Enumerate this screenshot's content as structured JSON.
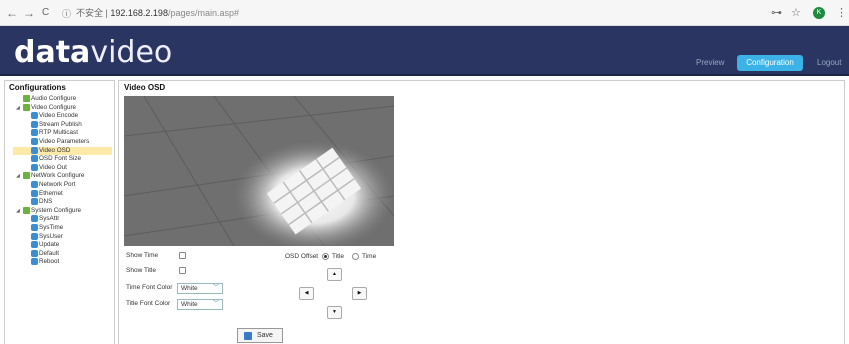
{
  "browser": {
    "back_icon": "←",
    "forward_icon": "→",
    "reload_icon": "C",
    "info_icon": "ⓘ",
    "security_label": "不安全",
    "separator": "|",
    "url_host": "192.168.2.198",
    "url_path": "/pages/main.asp#",
    "key_icon": "⊶",
    "star_icon": "☆",
    "avatar_letter": "K",
    "menu_icon": "⋮"
  },
  "header": {
    "logo_bold": "data",
    "logo_light": "video",
    "nav": {
      "preview": "Preview",
      "configuration": "Configuration",
      "logout": "Logout"
    },
    "active_color": "#3bb3e6"
  },
  "sidebar": {
    "title": "Configurations",
    "tree": [
      {
        "label": "Audio Configure",
        "type": "group"
      },
      {
        "label": "Video Configure",
        "type": "group",
        "expanded": true
      },
      {
        "label": "Video Encode",
        "type": "item"
      },
      {
        "label": "Stream Publish",
        "type": "item"
      },
      {
        "label": "RTP Multicast",
        "type": "item"
      },
      {
        "label": "Video Parameters",
        "type": "item"
      },
      {
        "label": "Video OSD",
        "type": "item",
        "selected": true
      },
      {
        "label": "OSD Font Size",
        "type": "item"
      },
      {
        "label": "Video Out",
        "type": "item"
      },
      {
        "label": "NetWork Configure",
        "type": "group",
        "expanded": true
      },
      {
        "label": "Network Port",
        "type": "item"
      },
      {
        "label": "Ethernet",
        "type": "item"
      },
      {
        "label": "DNS",
        "type": "item"
      },
      {
        "label": "System Configure",
        "type": "group",
        "expanded": true
      },
      {
        "label": "SysAttr",
        "type": "item"
      },
      {
        "label": "SysTime",
        "type": "item"
      },
      {
        "label": "SysUser",
        "type": "item"
      },
      {
        "label": "Update",
        "type": "item"
      },
      {
        "label": "Default",
        "type": "item"
      },
      {
        "label": "Reboot",
        "type": "item"
      }
    ]
  },
  "main": {
    "title": "Video OSD",
    "show_time_label": "Show Time",
    "show_title_label": "Show Title",
    "time_font_color_label": "Time Font Color",
    "time_font_color_value": "White",
    "title_font_color_label": "Title Font Color",
    "title_font_color_value": "White",
    "osd_offset_label": "OSD Offset",
    "offset_options": [
      {
        "label": "Title",
        "checked": true
      },
      {
        "label": "Time",
        "checked": false
      }
    ],
    "arrows": {
      "up": "▲",
      "left": "◀",
      "right": "▶",
      "down": "▼"
    },
    "save_label": "Save"
  }
}
